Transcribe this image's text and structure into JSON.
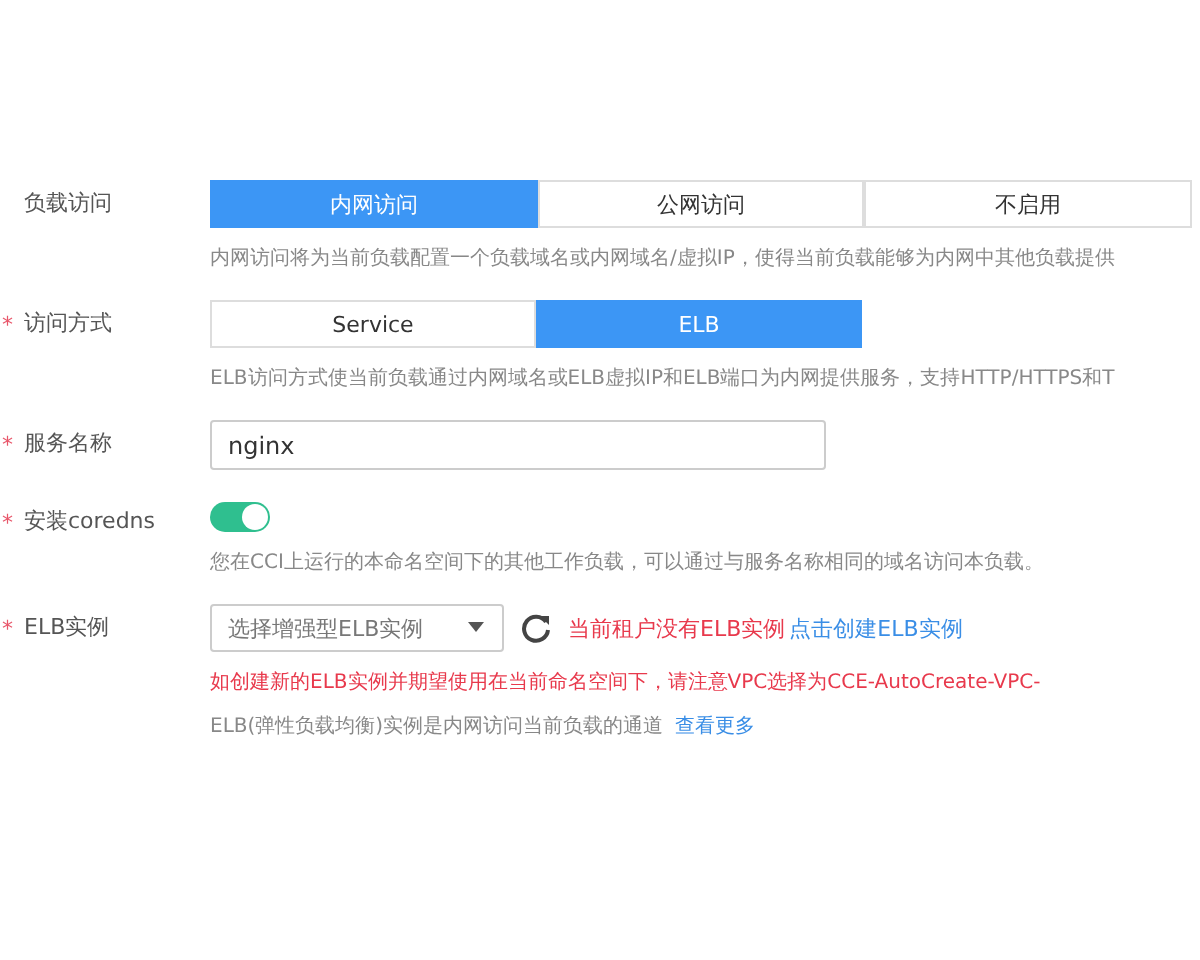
{
  "form": [
    {
      "kind": "segmented",
      "label": "负载访问",
      "options": [
        {
          "label": "内网访问",
          "selected": true
        },
        {
          "label": "公网访问",
          "selected": false
        },
        {
          "label": "不启用",
          "selected": false
        }
      ],
      "wide": true,
      "help": "内网访问将为当前负载配置一个负载域名或内网域名/虚拟IP，使得当前负载能够为内网中其他负载提供"
    },
    {
      "kind": "segmented",
      "label": "访问方式",
      "required_mark": "*",
      "options": [
        {
          "label": "Service",
          "selected": false
        },
        {
          "label": "ELB",
          "selected": true
        }
      ],
      "wide": false,
      "help": "ELB访问方式使当前负载通过内网域名或ELB虚拟IP和ELB端口为内网提供服务，支持HTTP/HTTPS和T"
    },
    {
      "kind": "input",
      "label": "服务名称",
      "required_mark": "*",
      "value": "nginx"
    },
    {
      "kind": "toggle",
      "label": "安装coredns",
      "required_mark": "*",
      "on": true,
      "help": "您在CCI上运行的本命名空间下的其他工作负载，可以通过与服务名称相同的域名访问本负载。"
    },
    {
      "kind": "select",
      "label": "ELB实例",
      "required_mark": "*",
      "placeholder": "选择增强型ELB实例",
      "error": "当前租户没有ELB实例",
      "link": "点击创建ELB实例",
      "warning": "如创建新的ELB实例并期望使用在当前命名空间下，请注意VPC选择为CCE-AutoCreate-VPC-",
      "note": "ELB(弹性负载均衡)实例是内网访问当前负载的通道",
      "note_link": "查看更多"
    }
  ]
}
